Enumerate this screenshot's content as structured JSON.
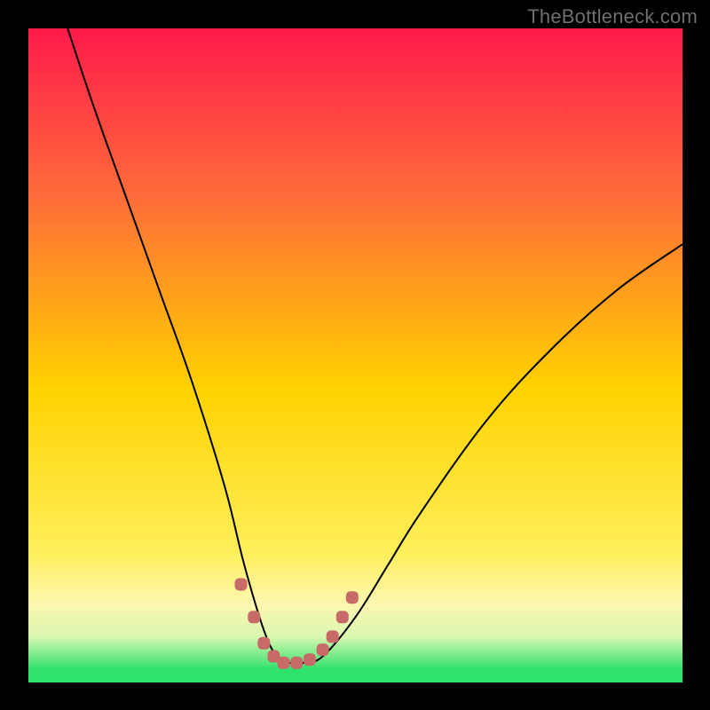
{
  "watermark": "TheBottleneck.com",
  "colors": {
    "top": "#ff1a4b",
    "upper": "#ff6a3a",
    "mid": "#ffd200",
    "low": "#ffef5a",
    "cream": "#fdf7b0",
    "pale": "#d9f7b0",
    "green": "#2fe26b",
    "curve": "#000000",
    "marker": "#c86a68"
  },
  "chart_data": {
    "type": "line",
    "title": "",
    "xlabel": "",
    "ylabel": "",
    "xlim": [
      0,
      100
    ],
    "ylim": [
      0,
      100
    ],
    "series": [
      {
        "name": "bottleneck-curve",
        "x": [
          6,
          10,
          15,
          20,
          25,
          30,
          33,
          36,
          38,
          40,
          42,
          45,
          50,
          55,
          60,
          70,
          80,
          90,
          100
        ],
        "y": [
          100,
          88,
          74,
          60,
          46,
          30,
          18,
          8,
          4,
          3,
          3,
          4,
          10,
          18,
          26,
          40,
          51,
          60,
          67
        ]
      }
    ],
    "markers": {
      "name": "highlight-points",
      "x": [
        32.5,
        34.5,
        36,
        37.5,
        39,
        41,
        43,
        45,
        46.5,
        48,
        49.5
      ],
      "y": [
        15,
        10,
        6,
        4,
        3,
        3,
        3.5,
        5,
        7,
        10,
        13
      ]
    }
  }
}
